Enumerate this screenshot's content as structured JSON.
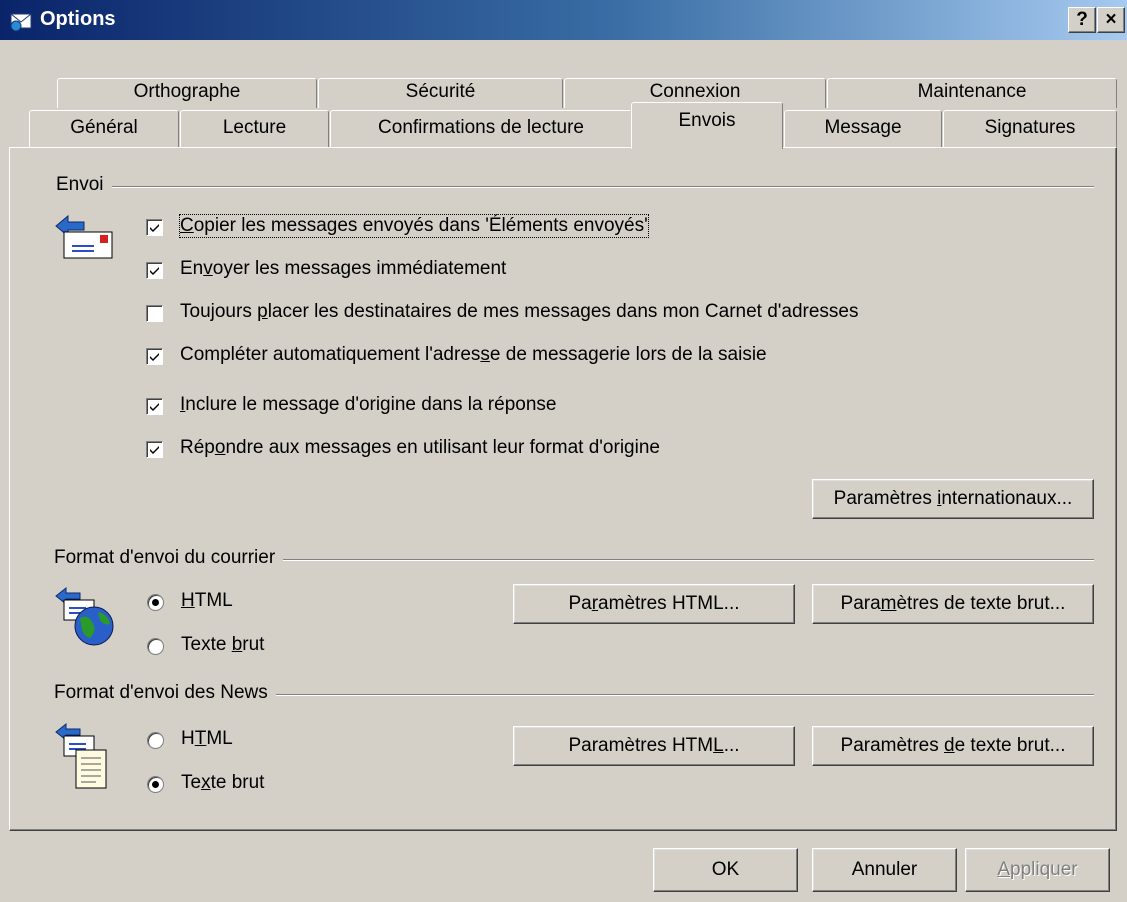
{
  "window": {
    "title": "Options",
    "help_glyph": "?",
    "close_glyph": "×"
  },
  "tabs_row1": [
    {
      "label": "Orthographe"
    },
    {
      "label": "Sécurité"
    },
    {
      "label": "Connexion"
    },
    {
      "label": "Maintenance"
    }
  ],
  "tabs_row2": [
    {
      "label": "Général"
    },
    {
      "label": "Lecture"
    },
    {
      "label": "Confirmations de lecture"
    },
    {
      "label": "Envois",
      "active": true
    },
    {
      "label": "Message"
    },
    {
      "label": "Signatures"
    }
  ],
  "envoi": {
    "group_label": "Envoi",
    "options": [
      {
        "pre": "",
        "ul": "C",
        "post": "opier les messages envoyés dans 'Éléments envoyés'",
        "checked": true
      },
      {
        "pre": "En",
        "ul": "v",
        "post": "oyer les messages immédiatement",
        "checked": true
      },
      {
        "pre": "Toujours ",
        "ul": "p",
        "post": "lacer les destinataires de mes messages dans mon Carnet d'adresses",
        "checked": false
      },
      {
        "pre": "Compléter automatiquement l'adres",
        "ul": "s",
        "post": "e de messagerie lors de la saisie",
        "checked": true
      },
      {
        "pre": "",
        "ul": "I",
        "post": "nclure le message d'origine dans la réponse",
        "checked": true
      },
      {
        "pre": "Rép",
        "ul": "o",
        "post": "ndre aux messages en utilisant leur format d'origine",
        "checked": true
      }
    ],
    "intl_button": {
      "pre": "Paramètres ",
      "ul": "i",
      "post": "nternationaux..."
    }
  },
  "mail_format": {
    "group_label": "Format d'envoi du courrier",
    "html": {
      "pre": "",
      "ul": "H",
      "post": "TML",
      "selected": true
    },
    "text": {
      "pre": "Texte ",
      "ul": "b",
      "post": "rut",
      "selected": false
    },
    "html_settings": {
      "pre": "Pa",
      "ul": "r",
      "post": "amètres HTML..."
    },
    "text_settings": {
      "pre": "Para",
      "ul": "m",
      "post": "ètres de texte brut..."
    }
  },
  "news_format": {
    "group_label": "Format d'envoi des News",
    "html": {
      "pre": "H",
      "ul": "T",
      "post": "ML",
      "selected": false
    },
    "text": {
      "pre": "Te",
      "ul": "x",
      "post": "te brut",
      "selected": true
    },
    "html_settings": {
      "pre": "Paramètres HTM",
      "ul": "L",
      "post": "..."
    },
    "text_settings": {
      "pre": "Paramètres ",
      "ul": "d",
      "post": "e texte brut..."
    }
  },
  "footer": {
    "ok": "OK",
    "cancel": "Annuler",
    "apply": {
      "pre": "",
      "ul": "A",
      "post": "ppliquer",
      "disabled": true
    }
  },
  "colors": {
    "face": "#d4d0c8",
    "title_start": "#0a246a",
    "title_end": "#a6caf0"
  }
}
